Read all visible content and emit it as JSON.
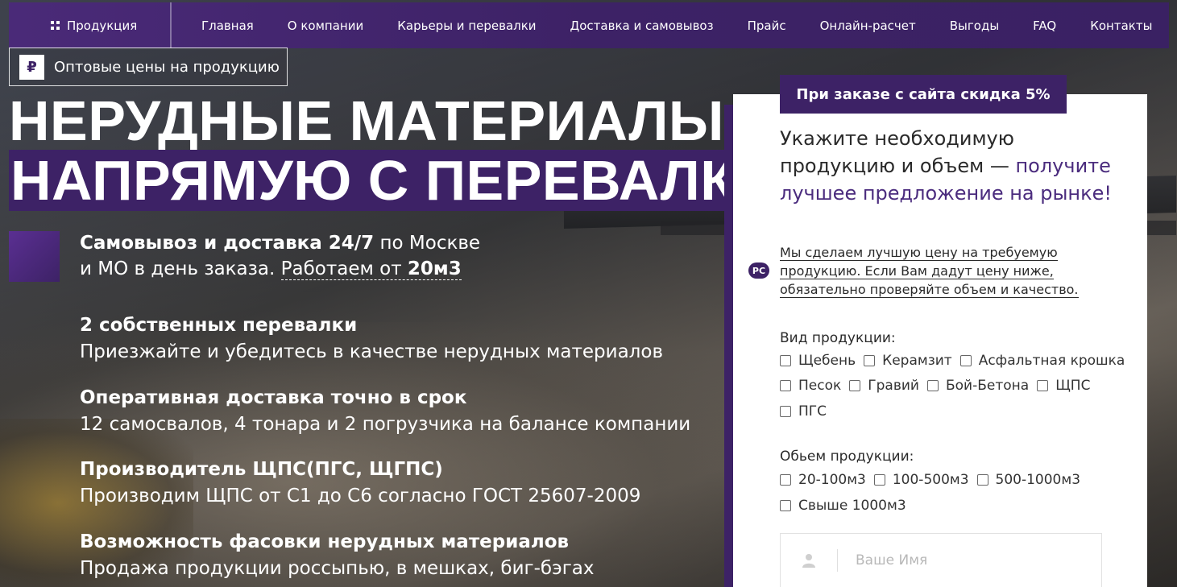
{
  "nav": {
    "products_label": "Продукция",
    "items": [
      "Главная",
      "О компании",
      "Карьеры и перевалки",
      "Доставка и самовывоз",
      "Прайс",
      "Онлайн-расчет",
      "Выгоды",
      "FAQ",
      "Контакты"
    ]
  },
  "wholesale": {
    "icon": "₽",
    "label": "Оптовые цены на продукцию"
  },
  "hero": {
    "line1": "НЕРУДНЫЕ МАТЕРИАЛЫ",
    "line2": "НАПРЯМУЮ С ПЕРЕВАЛКИ"
  },
  "features": [
    {
      "a_bold": "Самовывоз и доставка 24/7",
      "a_rest": " по Москве",
      "b_rest": "и МО в день заказа. ",
      "b_dotted": "Работаем от ",
      "b_dotted_bold": "20м3"
    },
    {
      "title": "2 собственных перевалки",
      "text": "Приезжайте и убедитесь в качестве нерудных материалов"
    },
    {
      "title": "Оперативная доставка точно в срок",
      "text": "12 самосвалов, 4 тонара и 2 погрузчика на балансе компании"
    },
    {
      "title": "Производитель ЩПС(ПГС, ЩГПС)",
      "text": "Производим ЩПС от С1 до С6 согласно ГОСТ 25607-2009"
    },
    {
      "title": "Возможность фасовки нерудных материалов",
      "text": "Продажа продукции россыпью, в мешках, биг-бэгах"
    }
  ],
  "form": {
    "discount": "При заказе с сайта скидка 5%",
    "title_plain": "Укажите необходимую продукцию и объем — ",
    "title_accent": "получите лучшее предложение на рынке!",
    "note_lines": [
      "Мы сделаем лучшую цену на требуемую",
      "продукцию. Если Вам дадут цену ниже,",
      "обязательно проверяйте объем и качество."
    ],
    "rs_logo": "РС",
    "product_label": "Вид продукции:",
    "products": [
      "Щебень",
      "Керамзит",
      "Асфальтная крошка",
      "Песок",
      "Гравий",
      "Бой-Бетона",
      "ЩПС",
      "ПГС"
    ],
    "volume_label": "Обьем продукции:",
    "volumes": [
      "20-100м3",
      "100-500м3",
      "500-1000м3",
      "Свыше 1000м3"
    ],
    "name_placeholder": "Ваше Имя"
  }
}
